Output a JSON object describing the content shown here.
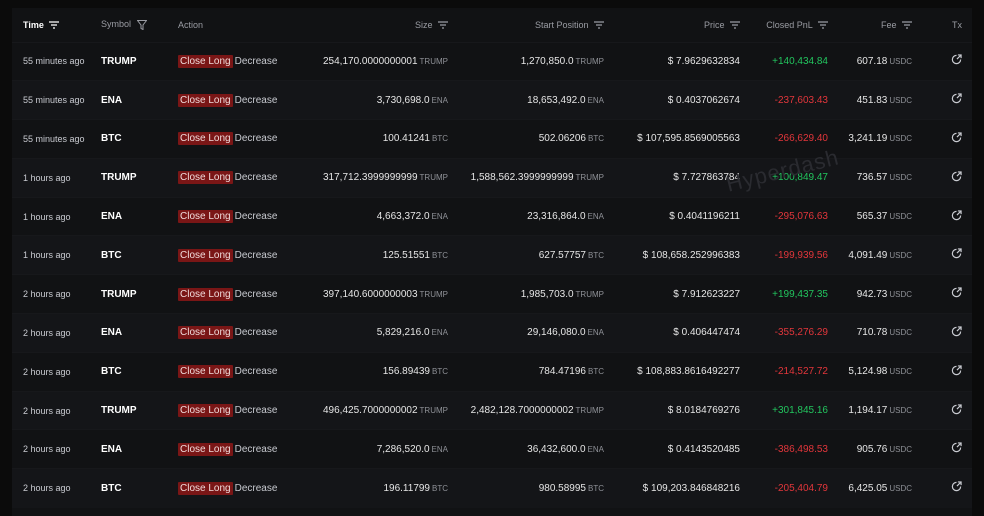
{
  "headers": {
    "time": "Time",
    "symbol": "Symbol",
    "action": "Action",
    "size": "Size",
    "start_position": "Start Position",
    "price": "Price",
    "closed_pnl": "Closed PnL",
    "fee": "Fee",
    "tx": "Tx"
  },
  "watermark": "Hyperdash",
  "icons": {
    "sort": "sort-icon",
    "filter": "filter-icon",
    "tx": "external-link-icon"
  },
  "colors": {
    "positive": "#22c55e",
    "negative": "#e2363b",
    "badge": "#7a1616"
  },
  "rows": [
    {
      "time": "55 minutes ago",
      "symbol": "TRUMP",
      "action": "Close Long",
      "direction": "Decrease",
      "size": "254,170.0000000001",
      "size_unit": "TRUMP",
      "start": "1,270,850.0",
      "start_unit": "TRUMP",
      "price": "$ 7.9629632834",
      "pnl": "+140,434.84",
      "pnl_sign": "pos",
      "fee": "607.18",
      "fee_unit": "USDC"
    },
    {
      "time": "55 minutes ago",
      "symbol": "ENA",
      "action": "Close Long",
      "direction": "Decrease",
      "size": "3,730,698.0",
      "size_unit": "ENA",
      "start": "18,653,492.0",
      "start_unit": "ENA",
      "price": "$ 0.4037062674",
      "pnl": "-237,603.43",
      "pnl_sign": "neg",
      "fee": "451.83",
      "fee_unit": "USDC"
    },
    {
      "time": "55 minutes ago",
      "symbol": "BTC",
      "action": "Close Long",
      "direction": "Decrease",
      "size": "100.41241",
      "size_unit": "BTC",
      "start": "502.06206",
      "start_unit": "BTC",
      "price": "$ 107,595.8569005563",
      "pnl": "-266,629.40",
      "pnl_sign": "neg",
      "fee": "3,241.19",
      "fee_unit": "USDC"
    },
    {
      "time": "1 hours ago",
      "symbol": "TRUMP",
      "action": "Close Long",
      "direction": "Decrease",
      "size": "317,712.3999999999",
      "size_unit": "TRUMP",
      "start": "1,588,562.3999999999",
      "start_unit": "TRUMP",
      "price": "$ 7.727863784",
      "pnl": "+100,849.47",
      "pnl_sign": "pos",
      "fee": "736.57",
      "fee_unit": "USDC"
    },
    {
      "time": "1 hours ago",
      "symbol": "ENA",
      "action": "Close Long",
      "direction": "Decrease",
      "size": "4,663,372.0",
      "size_unit": "ENA",
      "start": "23,316,864.0",
      "start_unit": "ENA",
      "price": "$ 0.4041196211",
      "pnl": "-295,076.63",
      "pnl_sign": "neg",
      "fee": "565.37",
      "fee_unit": "USDC"
    },
    {
      "time": "1 hours ago",
      "symbol": "BTC",
      "action": "Close Long",
      "direction": "Decrease",
      "size": "125.51551",
      "size_unit": "BTC",
      "start": "627.57757",
      "start_unit": "BTC",
      "price": "$ 108,658.252996383",
      "pnl": "-199,939.56",
      "pnl_sign": "neg",
      "fee": "4,091.49",
      "fee_unit": "USDC"
    },
    {
      "time": "2 hours ago",
      "symbol": "TRUMP",
      "action": "Close Long",
      "direction": "Decrease",
      "size": "397,140.6000000003",
      "size_unit": "TRUMP",
      "start": "1,985,703.0",
      "start_unit": "TRUMP",
      "price": "$ 7.912623227",
      "pnl": "+199,437.35",
      "pnl_sign": "pos",
      "fee": "942.73",
      "fee_unit": "USDC"
    },
    {
      "time": "2 hours ago",
      "symbol": "ENA",
      "action": "Close Long",
      "direction": "Decrease",
      "size": "5,829,216.0",
      "size_unit": "ENA",
      "start": "29,146,080.0",
      "start_unit": "ENA",
      "price": "$ 0.406447474",
      "pnl": "-355,276.29",
      "pnl_sign": "neg",
      "fee": "710.78",
      "fee_unit": "USDC"
    },
    {
      "time": "2 hours ago",
      "symbol": "BTC",
      "action": "Close Long",
      "direction": "Decrease",
      "size": "156.89439",
      "size_unit": "BTC",
      "start": "784.47196",
      "start_unit": "BTC",
      "price": "$ 108,883.8616492277",
      "pnl": "-214,527.72",
      "pnl_sign": "neg",
      "fee": "5,124.98",
      "fee_unit": "USDC"
    },
    {
      "time": "2 hours ago",
      "symbol": "TRUMP",
      "action": "Close Long",
      "direction": "Decrease",
      "size": "496,425.7000000002",
      "size_unit": "TRUMP",
      "start": "2,482,128.7000000002",
      "start_unit": "TRUMP",
      "price": "$ 8.0184769276",
      "pnl": "+301,845.16",
      "pnl_sign": "pos",
      "fee": "1,194.17",
      "fee_unit": "USDC"
    },
    {
      "time": "2 hours ago",
      "symbol": "ENA",
      "action": "Close Long",
      "direction": "Decrease",
      "size": "7,286,520.0",
      "size_unit": "ENA",
      "start": "36,432,600.0",
      "start_unit": "ENA",
      "price": "$ 0.4143520485",
      "pnl": "-386,498.53",
      "pnl_sign": "neg",
      "fee": "905.76",
      "fee_unit": "USDC"
    },
    {
      "time": "2 hours ago",
      "symbol": "BTC",
      "action": "Close Long",
      "direction": "Decrease",
      "size": "196.11799",
      "size_unit": "BTC",
      "start": "980.58995",
      "start_unit": "BTC",
      "price": "$ 109,203.846848216",
      "pnl": "-205,404.79",
      "pnl_sign": "neg",
      "fee": "6,425.05",
      "fee_unit": "USDC"
    }
  ]
}
